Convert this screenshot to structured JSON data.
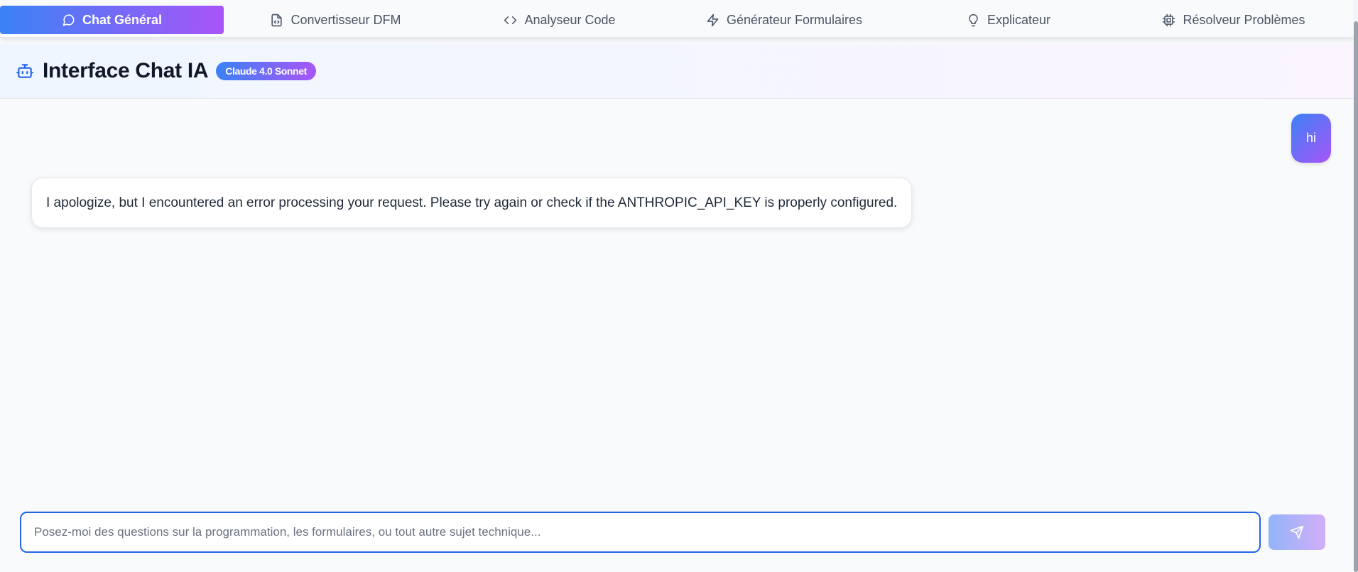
{
  "tabs": [
    {
      "label": "Chat Général",
      "icon": "message-circle-icon",
      "active": true
    },
    {
      "label": "Convertisseur DFM",
      "icon": "file-code-icon",
      "active": false
    },
    {
      "label": "Analyseur Code",
      "icon": "code-icon",
      "active": false
    },
    {
      "label": "Générateur Formulaires",
      "icon": "zap-icon",
      "active": false
    },
    {
      "label": "Explicateur",
      "icon": "lightbulb-icon",
      "active": false
    },
    {
      "label": "Résolveur Problèmes",
      "icon": "cpu-icon",
      "active": false
    }
  ],
  "header": {
    "icon": "bot-icon",
    "title": "Interface Chat IA",
    "badge": "Claude 4.0 Sonnet"
  },
  "messages": [
    {
      "role": "user",
      "text": "hi"
    },
    {
      "role": "assistant",
      "text": "I apologize, but I encountered an error processing your request. Please try again or check if the ANTHROPIC_API_KEY is properly configured."
    }
  ],
  "input": {
    "value": "",
    "placeholder": "Posez-moi des questions sur la programmation, les formulaires, ou tout autre sujet technique...",
    "send_icon": "send-icon"
  },
  "colors": {
    "accent_start": "#3b82f6",
    "accent_end": "#a855f7",
    "focus_border": "#2563eb"
  }
}
